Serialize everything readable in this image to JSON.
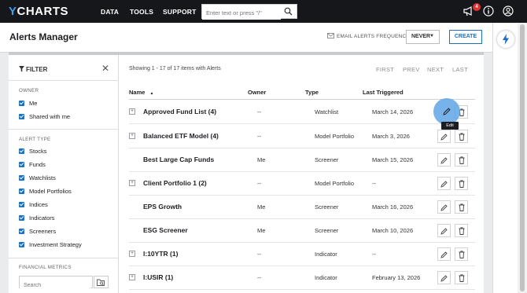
{
  "nav": {
    "logo": "YCHARTS",
    "logo_y": "Y",
    "logo_rest": "CHARTS",
    "items": [
      "DATA",
      "TOOLS",
      "SUPPORT"
    ],
    "search_placeholder": "Enter text or press \"/\"",
    "notification_count": "4"
  },
  "header": {
    "title": "Alerts Manager",
    "frequency_label": "EMAIL ALERTS FREQUENCY:",
    "frequency_value": "NEVER",
    "create_label": "CREATE"
  },
  "filter": {
    "title": "FILTER",
    "owner_label": "OWNER",
    "owner_options": [
      "Me",
      "Shared with me"
    ],
    "alert_type_label": "ALERT TYPE",
    "alert_types": [
      "Stocks",
      "Funds",
      "Watchlists",
      "Model Portfolios",
      "Indices",
      "Indicators",
      "Screeners",
      "Investment Strategy"
    ],
    "financial_metrics_label": "FINANCIAL METRICS",
    "search_placeholder": "Search"
  },
  "table": {
    "showing": "Showing 1 - 17 of 17 items with Alerts",
    "pager": [
      "FIRST",
      "PREV",
      "NEXT",
      "LAST"
    ],
    "columns": [
      "Name",
      "Owner",
      "Type",
      "Last Triggered"
    ],
    "sort_indicator": "▲",
    "rows": [
      {
        "name": "Approved Fund List (4)",
        "owner": "--",
        "type": "Watchlist",
        "last": "March 14, 2026",
        "expandable": true
      },
      {
        "name": "Balanced ETF Model (4)",
        "owner": "--",
        "type": "Model Portfolio",
        "last": "March 3, 2026",
        "expandable": true
      },
      {
        "name": "Best Large Cap Funds",
        "owner": "Me",
        "type": "Screener",
        "last": "March 15, 2026",
        "expandable": false
      },
      {
        "name": "Client Portfolio 1 (2)",
        "owner": "--",
        "type": "Model Portfolio",
        "last": "--",
        "expandable": true
      },
      {
        "name": "EPS Growth",
        "owner": "Me",
        "type": "Screener",
        "last": "March 16, 2026",
        "expandable": false
      },
      {
        "name": "ESG Screener",
        "owner": "Me",
        "type": "Screener",
        "last": "March 10, 2026",
        "expandable": false
      },
      {
        "name": "I:10YTR (1)",
        "owner": "--",
        "type": "Indicator",
        "last": "--",
        "expandable": true
      },
      {
        "name": "I:USIR (1)",
        "owner": "--",
        "type": "Indicator",
        "last": "February 13, 2026",
        "expandable": true
      }
    ],
    "tooltip": "Edit"
  },
  "colors": {
    "accent": "#1d6fbf",
    "topbar": "#15171a",
    "highlight": "#60a4e6"
  }
}
